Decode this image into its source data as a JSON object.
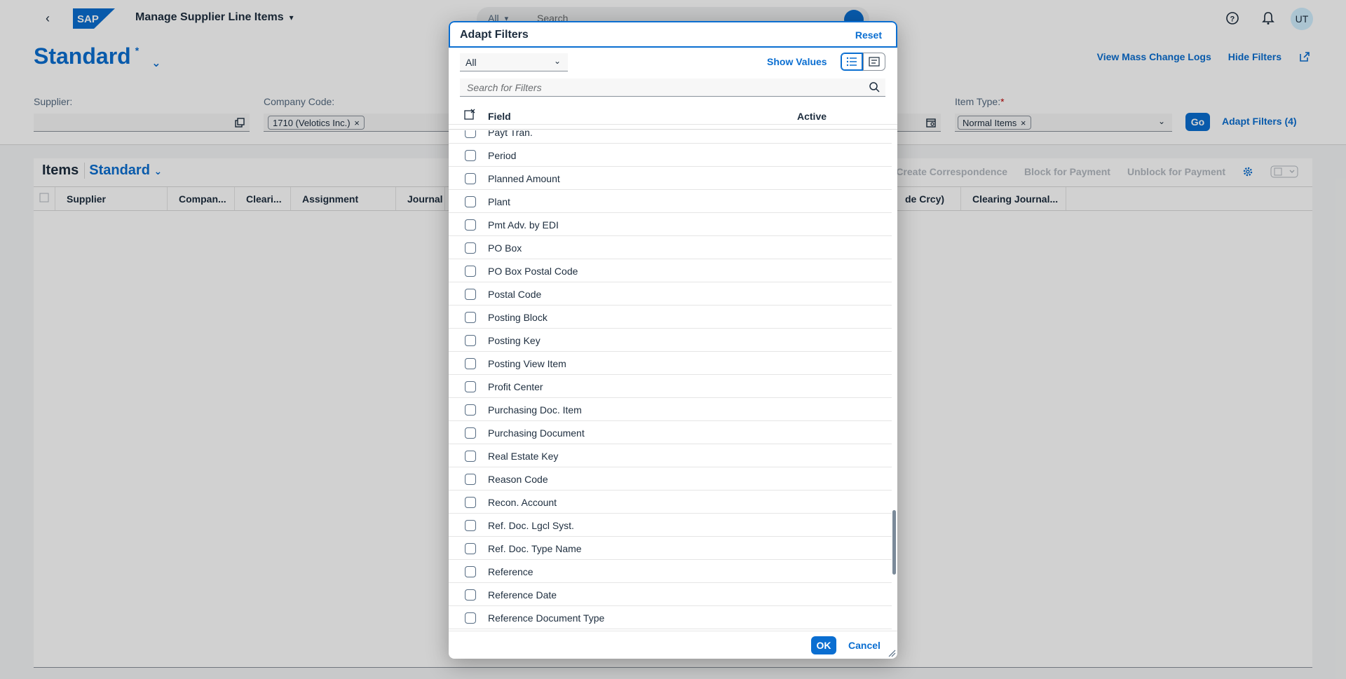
{
  "shell": {
    "app_title": "Manage Supplier Line Items",
    "search_scope": "All",
    "search_placeholder": "Search",
    "avatar_initials": "UT",
    "brand_color": "#0a6ed1"
  },
  "header": {
    "variant_name": "Standard",
    "variant_modified_marker": "*",
    "links": [
      "View Mass Change Logs",
      "Hide Filters"
    ],
    "filters": {
      "supplier_label": "Supplier:",
      "company_code_label": "Company Code:",
      "company_code_token": "1710 (Velotics Inc.)",
      "item_type_label": "Item Type:",
      "item_type_required": "*",
      "item_type_token": "Normal Items",
      "go_label": "Go",
      "adapt_filters_label": "Adapt Filters (4)"
    }
  },
  "table": {
    "title": "Items",
    "variant": "Standard",
    "actions": [
      "Create Correspondence",
      "Block for Payment",
      "Unblock for Payment"
    ],
    "columns": [
      "Supplier",
      "Compan...",
      "Cleari...",
      "Assignment",
      "Journal E",
      "de Crcy)",
      "Clearing Journal..."
    ]
  },
  "dialog": {
    "title": "Adapt Filters",
    "reset_label": "Reset",
    "select_value": "All",
    "show_values_label": "Show Values",
    "search_placeholder": "Search for Filters",
    "col_field": "Field",
    "col_active": "Active",
    "items": [
      "Payt Tran.",
      "Period",
      "Planned Amount",
      "Plant",
      "Pmt Adv. by EDI",
      "PO Box",
      "PO Box Postal Code",
      "Postal Code",
      "Posting Block",
      "Posting Key",
      "Posting View Item",
      "Profit Center",
      "Purchasing Doc. Item",
      "Purchasing Document",
      "Real Estate Key",
      "Reason Code",
      "Recon. Account",
      "Ref. Doc. Lgcl Syst.",
      "Ref. Doc. Type Name",
      "Reference",
      "Reference Date",
      "Reference Document Type"
    ],
    "ok_label": "OK",
    "cancel_label": "Cancel"
  }
}
